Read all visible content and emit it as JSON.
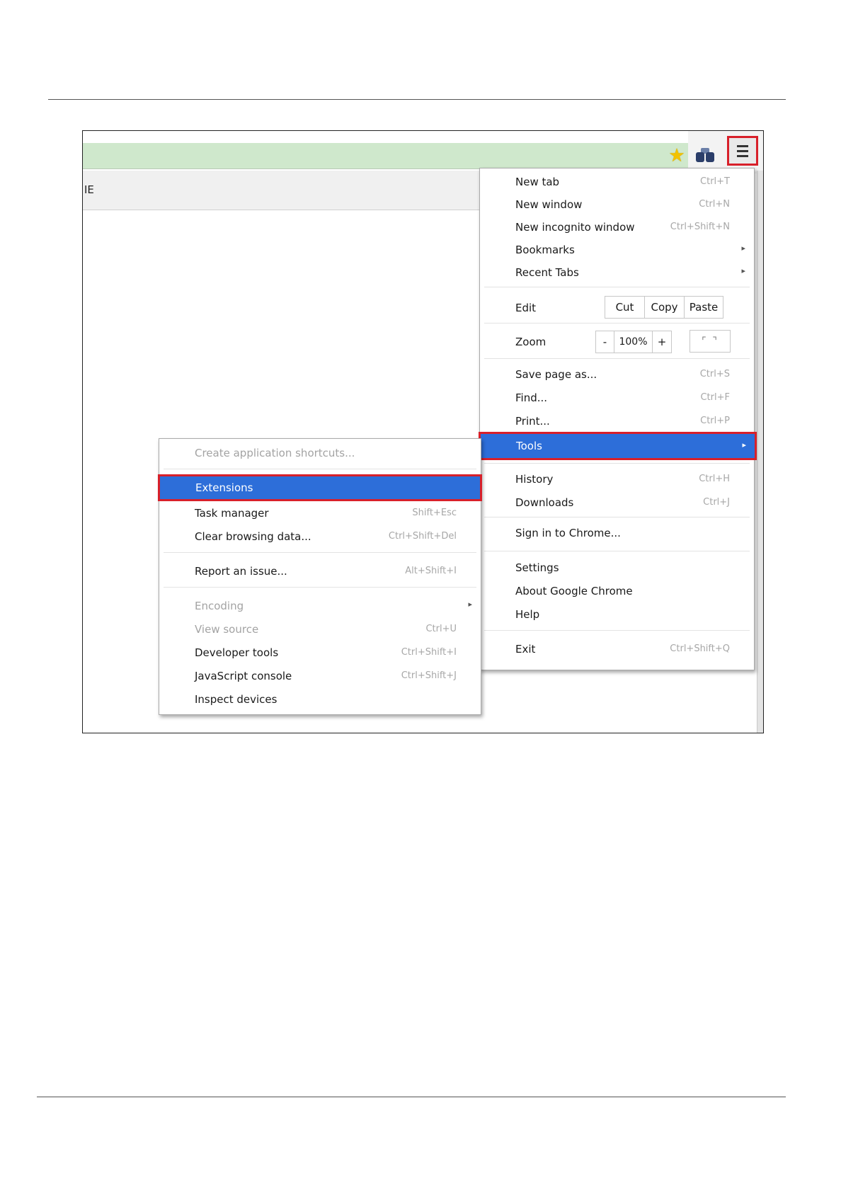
{
  "tab": {
    "text": "IE"
  },
  "toolbar": {
    "star_icon": "star-icon",
    "extension_icon": "binoculars-icon",
    "menu_icon": "hamburger-menu-icon"
  },
  "main_menu": {
    "items": [
      {
        "label": "New tab",
        "shortcut": "Ctrl+T"
      },
      {
        "label": "New window",
        "shortcut": "Ctrl+N"
      },
      {
        "label": "New incognito window",
        "shortcut": "Ctrl+Shift+N"
      },
      {
        "label": "Bookmarks",
        "arrow": "▸"
      },
      {
        "label": "Recent Tabs",
        "arrow": "▸"
      }
    ],
    "edit": {
      "label": "Edit",
      "cut": "Cut",
      "copy": "Copy",
      "paste": "Paste"
    },
    "zoom": {
      "label": "Zoom",
      "minus": "-",
      "value": "100%",
      "plus": "+",
      "fullscreen": "⌜ ⌝"
    },
    "items2": [
      {
        "label": "Save page as...",
        "shortcut": "Ctrl+S"
      },
      {
        "label": "Find...",
        "shortcut": "Ctrl+F"
      },
      {
        "label": "Print...",
        "shortcut": "Ctrl+P"
      }
    ],
    "tools": {
      "label": "Tools",
      "arrow": "▸"
    },
    "items3": [
      {
        "label": "History",
        "shortcut": "Ctrl+H"
      },
      {
        "label": "Downloads",
        "shortcut": "Ctrl+J"
      }
    ],
    "signin": {
      "label": "Sign in to Chrome..."
    },
    "items4": [
      {
        "label": "Settings"
      },
      {
        "label": "About Google Chrome"
      },
      {
        "label": "Help"
      }
    ],
    "exit": {
      "label": "Exit",
      "shortcut": "Ctrl+Shift+Q"
    }
  },
  "sub_menu": {
    "create_shortcuts": {
      "label": "Create application shortcuts..."
    },
    "extensions": {
      "label": "Extensions"
    },
    "items": [
      {
        "label": "Task manager",
        "shortcut": "Shift+Esc"
      },
      {
        "label": "Clear browsing data...",
        "shortcut": "Ctrl+Shift+Del"
      }
    ],
    "report": {
      "label": "Report an issue...",
      "shortcut": "Alt+Shift+I"
    },
    "encoding": {
      "label": "Encoding",
      "arrow": "▸"
    },
    "view_source": {
      "label": "View source",
      "shortcut": "Ctrl+U"
    },
    "items2": [
      {
        "label": "Developer tools",
        "shortcut": "Ctrl+Shift+I"
      },
      {
        "label": "JavaScript console",
        "shortcut": "Ctrl+Shift+J"
      },
      {
        "label": "Inspect devices"
      }
    ]
  },
  "colors": {
    "highlight": "#2d6ed9",
    "annotation_border": "#d8202a",
    "omnibox": "#cfe8cc"
  }
}
